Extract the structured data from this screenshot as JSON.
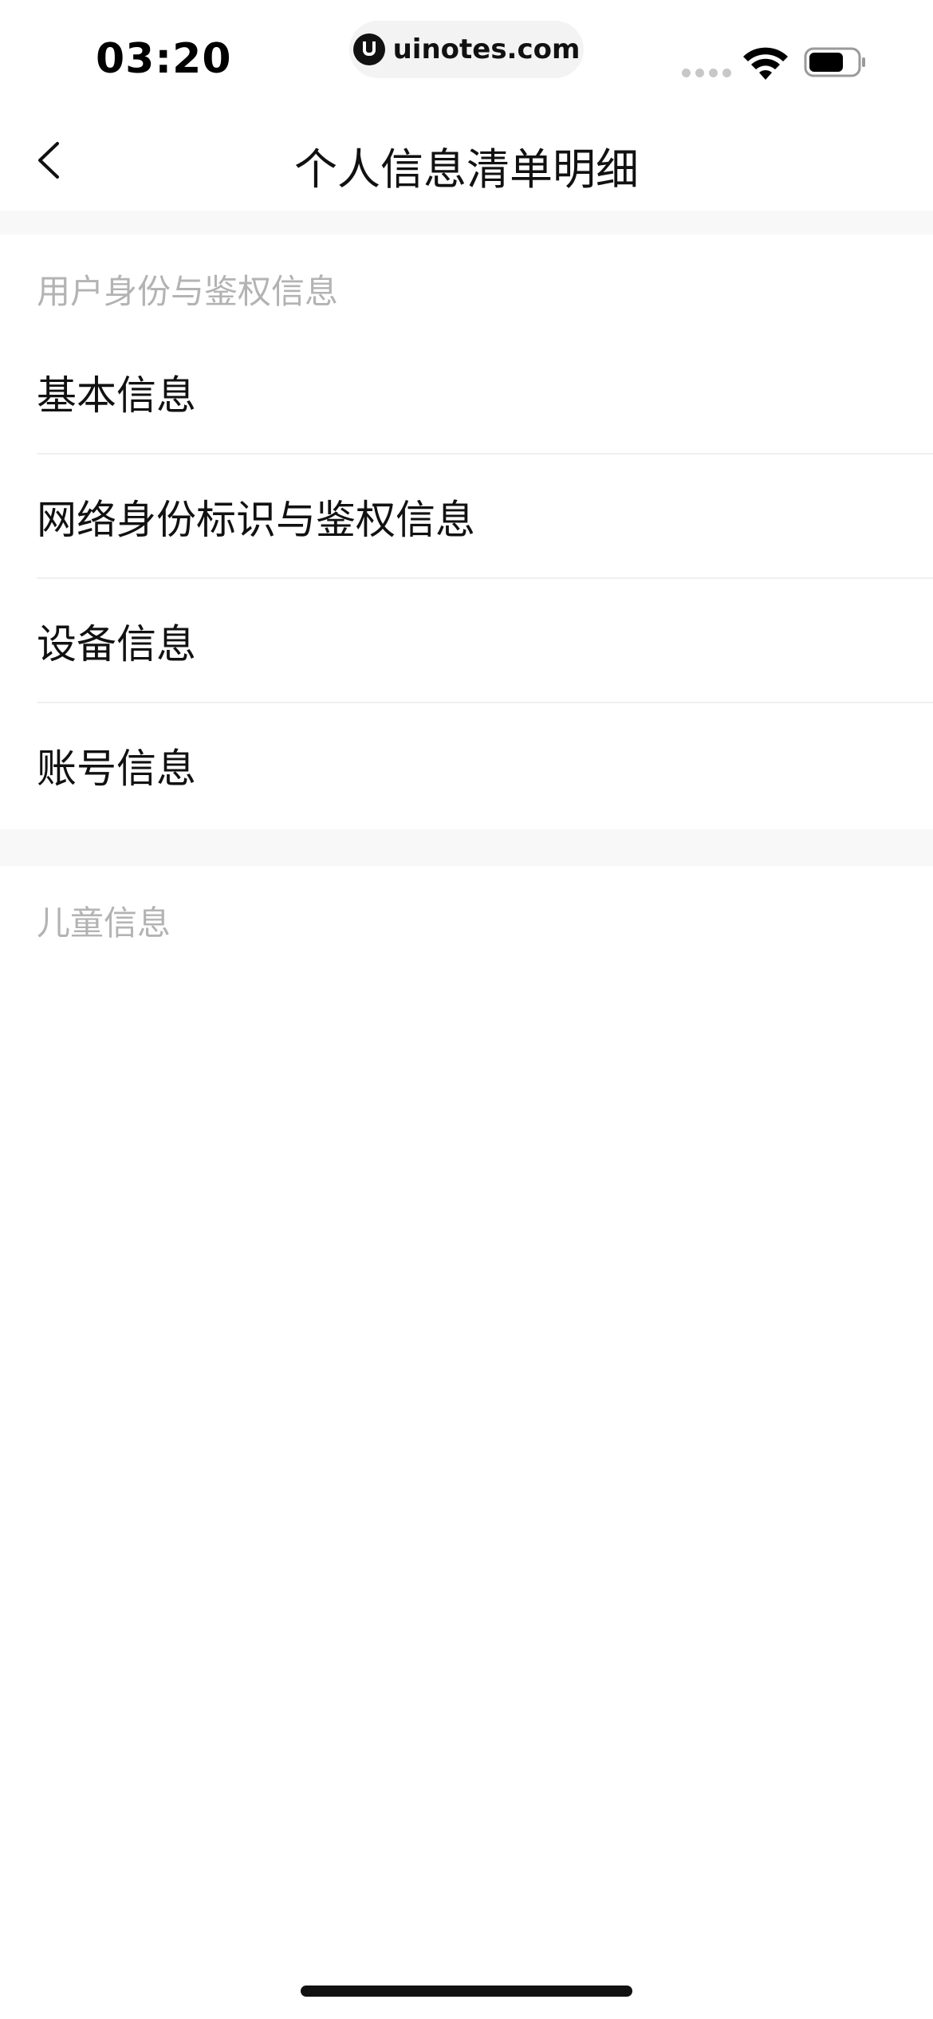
{
  "status_bar": {
    "time": "03:20",
    "url": "uinotes.com",
    "icons": [
      "cellular-signal-icon",
      "wifi-icon",
      "battery-icon"
    ]
  },
  "nav": {
    "back_icon": "chevron-left-icon",
    "title": "个人信息清单明细"
  },
  "sections": [
    {
      "header": "用户身份与鉴权信息",
      "items": [
        {
          "label": "基本信息"
        },
        {
          "label": "网络身份标识与鉴权信息"
        },
        {
          "label": "设备信息"
        },
        {
          "label": "账号信息"
        }
      ]
    },
    {
      "header": "儿童信息",
      "items": []
    }
  ],
  "colors": {
    "background": "#ffffff",
    "separator_band": "#f8f8f8",
    "section_header_text": "#b3b3b3",
    "item_text": "#111111"
  }
}
